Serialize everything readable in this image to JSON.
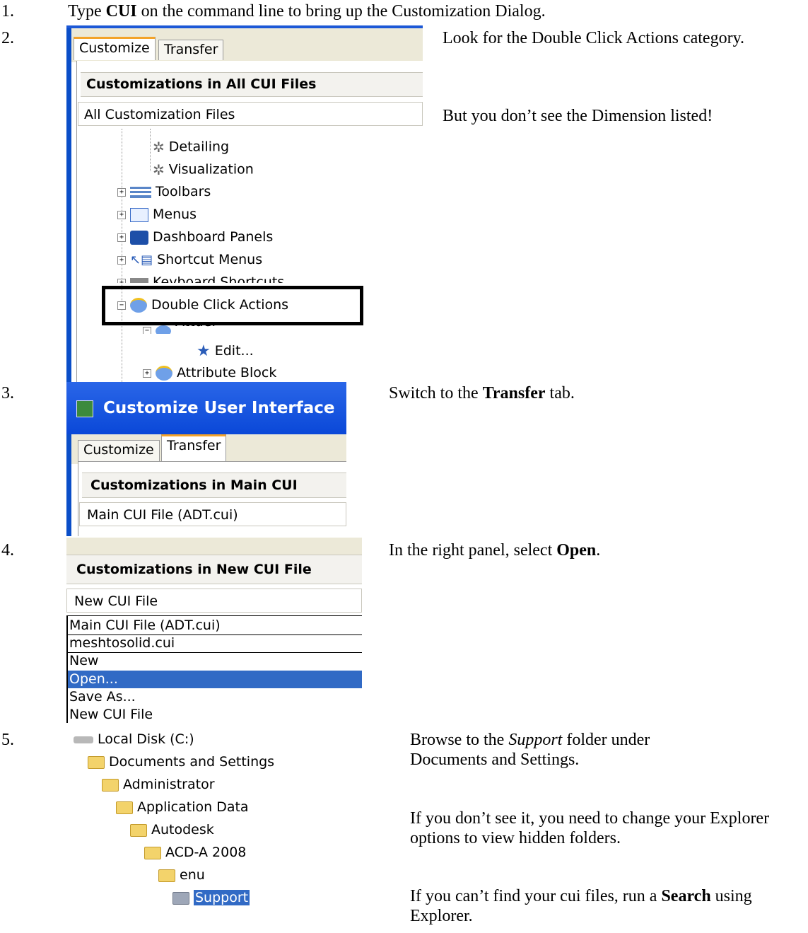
{
  "steps": [
    {
      "num": "1.",
      "parts": [
        {
          "text": "Type "
        },
        {
          "text": "CUI",
          "bold": true
        },
        {
          "text": " on the command line to bring up the Customization Dialog."
        }
      ]
    },
    {
      "num": "2.",
      "p1": "Look for the Double Click Actions category.",
      "p2": "But you don’t see the Dimension listed!"
    },
    {
      "num": "3.",
      "parts": [
        {
          "text": "Switch to the "
        },
        {
          "text": "Transfer",
          "bold": true
        },
        {
          "text": " tab."
        }
      ]
    },
    {
      "num": "4.",
      "parts": [
        {
          "text": "In the right panel, select "
        },
        {
          "text": "Open",
          "bold": true
        },
        {
          "text": "."
        }
      ]
    },
    {
      "num": "5.",
      "p1_parts": [
        {
          "text": "Browse to the "
        },
        {
          "text": "Support",
          "italic": true
        },
        {
          "text": " folder under Documents and Settings."
        }
      ],
      "p2": "If you don’t see it, you need to change your Explorer options to view hidden folders.",
      "p3_parts": [
        {
          "text": "If you can’t find your cui files, run a "
        },
        {
          "text": "Search",
          "bold": true
        },
        {
          "text": " using Explorer."
        }
      ]
    }
  ],
  "shot1": {
    "tab_customize": "Customize",
    "tab_transfer": "Transfer",
    "header": "Customizations in All CUI Files",
    "combo": "All Customization Files",
    "tree": [
      "Detailing",
      "Visualization",
      "Toolbars",
      "Menus",
      "Dashboard Panels",
      "Shortcut Menus",
      "Keyboard Shortcuts",
      "Double Click Actions",
      "Attdef",
      "Edit...",
      "Attribute Block"
    ]
  },
  "shot2": {
    "title": "Customize User Interface",
    "tab_customize": "Customize",
    "tab_transfer": "Transfer",
    "header": "Customizations in Main CUI",
    "combo": "Main CUI File (ADT.cui)"
  },
  "shot3": {
    "header": "Customizations in New CUI File",
    "combo": "New CUI File",
    "options": [
      "Main CUI File (ADT.cui)",
      "meshtosolid.cui",
      "New",
      "Open...",
      "Save As...",
      "New CUI File"
    ],
    "selected_index": 3,
    "selected_color": "#316ac5"
  },
  "shot4": {
    "tree": [
      "Local Disk (C:)",
      "Documents and Settings",
      "Administrator",
      "Application Data",
      "Autodesk",
      "ACD-A 2008",
      "enu",
      "Support"
    ]
  }
}
